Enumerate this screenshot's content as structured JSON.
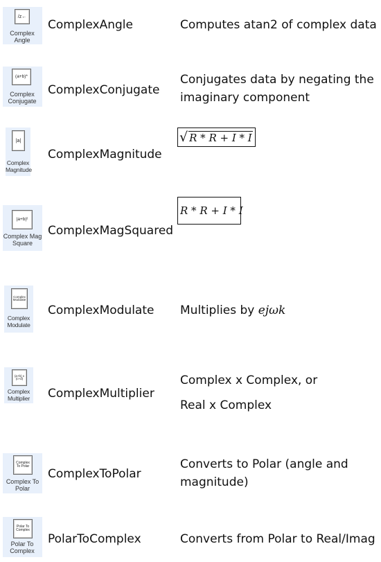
{
  "blocks": [
    {
      "icon": "angle-icon",
      "icon_symbol": "/z←",
      "label": "Complex Angle",
      "name": "ComplexAngle",
      "description": [
        "Computes atan2 of complex data"
      ]
    },
    {
      "icon": "conjugate-icon",
      "icon_symbol": "(a+b)*",
      "label": "Complex Conjugate",
      "name": "ComplexConjugate",
      "description": [
        "Conjugates data by negating the",
        "imaginary component"
      ]
    },
    {
      "icon": "magnitude-icon",
      "icon_symbol": "|a|",
      "label": "Complex Magnitude",
      "name": "ComplexMagnitude",
      "formula": "R * R + I * I"
    },
    {
      "icon": "mag-squared-icon",
      "icon_symbol": "|a+b|²",
      "label": "Complex Mag Square",
      "name": "ComplexMagSquared",
      "formula": "R * R + I * I"
    },
    {
      "icon": "modulate-icon",
      "icon_symbol": "Complex Modulate",
      "label": "Complex Modulate",
      "name": "ComplexModulate",
      "description_prefix": "Multiplies by ",
      "description_math": "ejωk"
    },
    {
      "icon": "multiplier-icon",
      "icon_symbol": "(a+b) x (c+d)",
      "label": "Complex Multiplier",
      "name": "ComplexMultiplier",
      "description": [
        "Complex x Complex, or",
        "Real x Complex"
      ]
    },
    {
      "icon": "to-polar-icon",
      "icon_symbol": "Complex To Polar",
      "label": "Complex To Polar",
      "name": "ComplexToPolar",
      "description": [
        "Converts to Polar (angle and",
        "magnitude)"
      ]
    },
    {
      "icon": "polar-to-complex-icon",
      "icon_symbol": "Polar To Complex",
      "label": "Polar To Complex",
      "name": "PolarToComplex",
      "description": [
        "Converts from Polar to Real/Imag"
      ]
    }
  ]
}
